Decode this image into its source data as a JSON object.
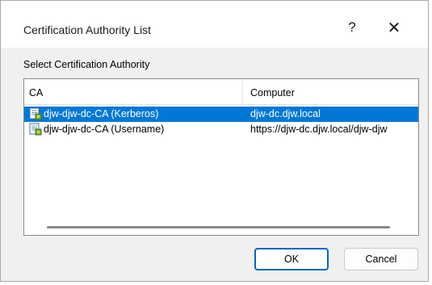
{
  "window": {
    "title": "Certification Authority List",
    "help_label": "?",
    "close_label": "✕"
  },
  "section_label": "Select Certification Authority",
  "list": {
    "columns": [
      "CA",
      "Computer"
    ],
    "rows": [
      {
        "ca": "djw-djw-dc-CA (Kerberos)",
        "computer": "djw-dc.djw.local",
        "selected": true,
        "icon": "certificate-authority-icon"
      },
      {
        "ca": "djw-djw-dc-CA (Username)",
        "computer": "https://djw-dc.djw.local/djw-djw",
        "selected": false,
        "icon": "certificate-authority-icon"
      }
    ]
  },
  "buttons": {
    "ok": "OK",
    "cancel": "Cancel"
  },
  "colors": {
    "selection": "#0078d7",
    "default_button_border": "#0067c0"
  }
}
